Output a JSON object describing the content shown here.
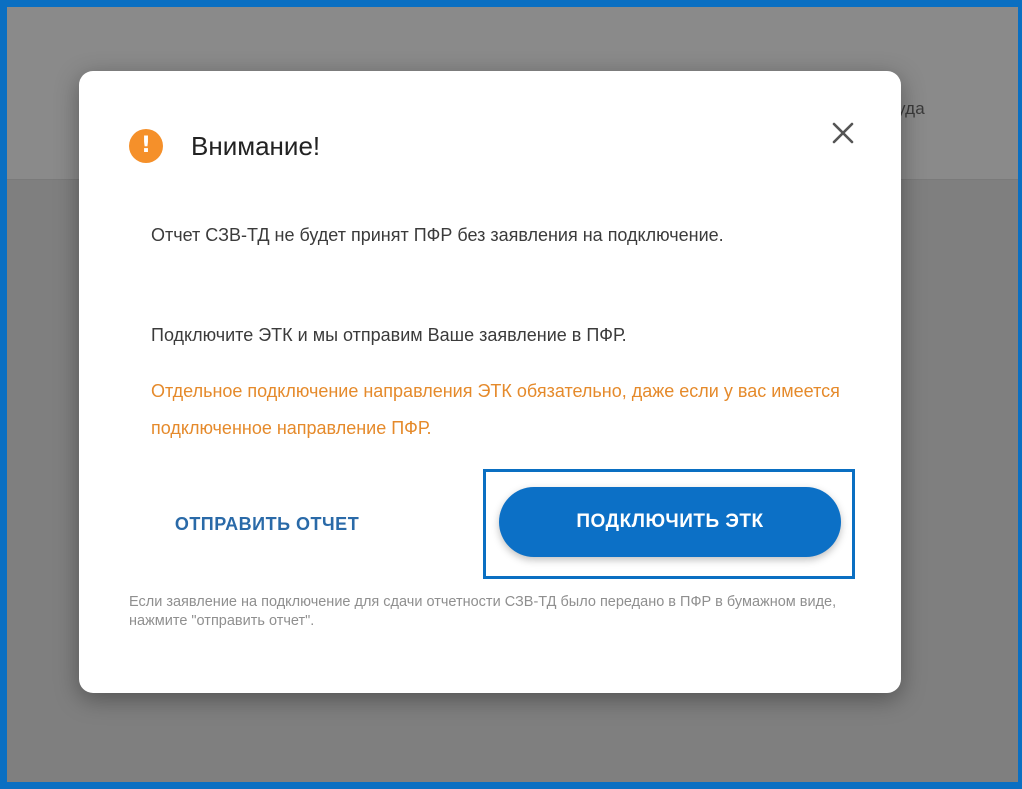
{
  "background": {
    "header_text": "уда"
  },
  "dialog": {
    "icon": "warning-exclamation-icon",
    "icon_glyph": "!",
    "title": "Внимание!",
    "close_icon": "close-icon",
    "paragraph_1": "Отчет СЗВ-ТД не будет принят ПФР без заявления на подключение.",
    "paragraph_2": "Подключите ЭТК и мы отправим Ваше заявление в ПФР.",
    "warning_text": "Отдельное подключение направления ЭТК обязательно, даже если у вас имеется подключенное направление ПФР.",
    "send_report_label": "ОТПРАВИТЬ ОТЧЕТ",
    "connect_label": "ПОДКЛЮЧИТЬ ЭТК",
    "footnote": "Если заявление на подключение для сдачи отчетности СЗВ-ТД было передано в ПФР в бумажном виде, нажмите \"отправить отчет\"."
  },
  "colors": {
    "accent": "#0c70c6",
    "warning": "#f5902a",
    "warning_text": "#e58a2b",
    "link": "#2a6aa8",
    "highlight_frame": "#0a6fc2"
  }
}
